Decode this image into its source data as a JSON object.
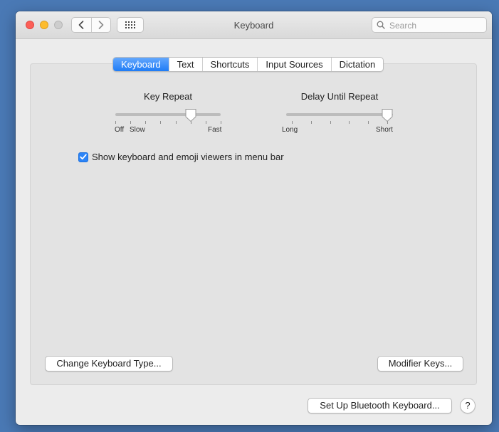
{
  "window": {
    "title": "Keyboard"
  },
  "search": {
    "placeholder": "Search",
    "value": ""
  },
  "tabs": [
    {
      "label": "Keyboard",
      "active": true
    },
    {
      "label": "Text",
      "active": false
    },
    {
      "label": "Shortcuts",
      "active": false
    },
    {
      "label": "Input Sources",
      "active": false
    },
    {
      "label": "Dictation",
      "active": false
    }
  ],
  "key_repeat": {
    "title": "Key Repeat",
    "labels": {
      "off": "Off",
      "slow": "Slow",
      "fast": "Fast"
    },
    "tick_count": 8,
    "selected_step": 5
  },
  "delay_until_repeat": {
    "title": "Delay Until Repeat",
    "labels": {
      "long": "Long",
      "short": "Short"
    },
    "tick_count": 6,
    "selected_step": 5
  },
  "options": {
    "show_viewers_label": "Show keyboard and emoji viewers in menu bar",
    "show_viewers_checked": true
  },
  "buttons": {
    "change_keyboard_type": "Change Keyboard Type...",
    "modifier_keys": "Modifier Keys...",
    "bluetooth_setup": "Set Up Bluetooth Keyboard...",
    "help": "?"
  },
  "colors": {
    "accent": "#2c84f7",
    "desktop": "#4a79b5"
  }
}
